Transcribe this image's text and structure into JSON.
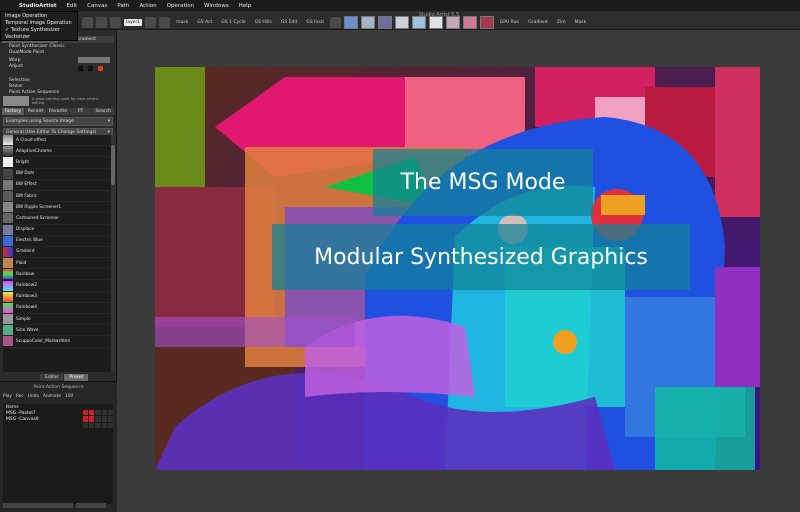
{
  "menubar": {
    "items": [
      "StudioArtist",
      "Edit",
      "Canvas",
      "Path",
      "Action",
      "Operation",
      "Windows",
      "Help"
    ]
  },
  "dropdown_menu": {
    "items": [
      "Image Operation",
      "Temporal Image Operation",
      "✓ Texture Synthesizer",
      "Vectorizer"
    ]
  },
  "window": {
    "title": "Studio Artist 5.5"
  },
  "toolbar": {
    "layer_field": "layer1",
    "texts": [
      "mask",
      "GS Act",
      "GS 1 Cycle",
      "GS Hills",
      "GS Edit",
      "GS Instl",
      "GPU Run",
      "Gradient",
      "Zlm",
      "Mask"
    ]
  },
  "left_panel": {
    "mode_label": "MSG",
    "mode_right": "Gradient",
    "rows_top": [
      "Paint Synthesizer Classic",
      "DualMode Paint",
      "Warp",
      "Adjust",
      "Selection",
      "Bezier",
      "Paint Action Sequence"
    ],
    "hint_text": "A great starting point for more artistic editing.",
    "tabs": [
      "Factory",
      "Recent",
      "Favorite",
      "PT",
      "Search"
    ],
    "category_select": "Examples using Source Image",
    "subcategory_select": "General (Use Editor To Change Settings)",
    "presets": [
      "A Cloud effect",
      "AdaptiveChrome",
      "Bright",
      "BW Dots",
      "BW Effect",
      "BW Fabric",
      "BW Ripple Screener1",
      "Cartooned Screener",
      "Displace",
      "Electric Blue",
      "Gradient",
      "Plaid",
      "Rainbow",
      "Rainbow2",
      "Rainbow3",
      "Rainbow4",
      "Simple",
      "Sine Wave",
      "ScuppoColor_Martwritten"
    ],
    "editor_tab": "Editor",
    "preset_tab": "Preset"
  },
  "sequence_panel": {
    "title": "Paint Action Sequence",
    "controls": [
      "Play",
      "Rec",
      "Undo",
      "Animate",
      "100"
    ],
    "items": [
      "Items",
      "MSG -Pastel7",
      "MSG -Canvas9"
    ]
  },
  "canvas": {
    "caption_line1": "The MSG Mode",
    "caption_line2": "Modular Synthesized Graphics"
  },
  "colors": {
    "menubar_bg": "#1b1b1b",
    "panel_bg": "#2b2b2b",
    "workspace_bg": "#3b3b3b",
    "caption_bg": "#1082a0"
  }
}
